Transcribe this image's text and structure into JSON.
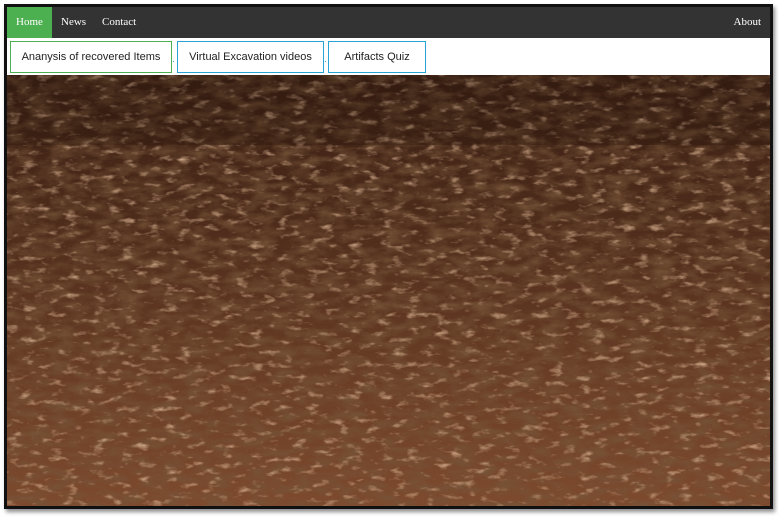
{
  "nav": {
    "home": "Home",
    "news": "News",
    "contact": "Contact",
    "about": "About"
  },
  "tabs": [
    {
      "label": "Ananysis of recovered Items"
    },
    {
      "label": "Virtual Excavation videos"
    },
    {
      "label": "Artifacts Quiz"
    }
  ],
  "separators": [
    ".",
    "."
  ],
  "colors": {
    "nav_bg": "#333333",
    "active": "#4caf50",
    "tab_border": "#29a3d3",
    "soil": "#5a3320"
  },
  "hero": {
    "image": "plowed-soil-field"
  }
}
